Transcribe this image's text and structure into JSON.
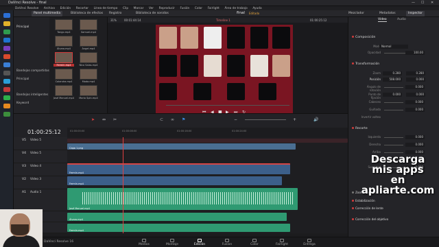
{
  "app": {
    "title": "DaVinci Resolve - final",
    "project_title": "final",
    "edited_label": "Editado"
  },
  "menu": [
    "DaVinci Resolve",
    "Archivo",
    "Edición",
    "Recortar",
    "Línea de tiempo",
    "Clip",
    "Marcar",
    "Ver",
    "Reproducir",
    "Fusión",
    "Color",
    "Fairlight",
    "Área de trabajo",
    "Ayuda"
  ],
  "toolbar": {
    "media_pool": "Panel multimedia",
    "effects": "Biblioteca de efectos",
    "index": "Registro",
    "sound": "Biblioteca de sonidos",
    "mixer": "Mezclador",
    "metadata": "Metadatos",
    "inspector": "Inspector"
  },
  "viewer": {
    "zoom": "31%",
    "src_timecode": "00:01:44:14",
    "timeline_name": "Timeline 1",
    "rec_timecode": "01:00:25:12"
  },
  "left_panel": {
    "master": "Principal",
    "smart_bins": "Bandejas compartidas",
    "key_master": "Principal",
    "smart_bins2": "Bandejas inteligentes",
    "keywords": "Keyword"
  },
  "media_pool": [
    {
      "label": "Tango.mp4"
    },
    {
      "label": "Samuel.mp4"
    },
    {
      "label": "Álvaro.mp4"
    },
    {
      "label": "Ángel.mp4"
    },
    {
      "label": "Fermín.mp4"
    },
    {
      "label": "Nico Salas.mp4"
    },
    {
      "label": "Calandra.mp4"
    },
    {
      "label": "Moda.mp4"
    },
    {
      "label": "José Manuel.mp4"
    },
    {
      "label": "Mario Spin.mp4"
    }
  ],
  "inspector": {
    "tab_video": "Video",
    "tab_audio": "Audio",
    "composite": "Composición",
    "mode_label": "Modo",
    "mode_value": "Normal",
    "opacity_label": "Opacidad",
    "opacity_value": "100.00",
    "transform": "Transformación",
    "zoom_label": "Zoom",
    "zoom_x": "0.280",
    "zoom_y": "0.280",
    "pos_label": "Posición",
    "pos_x": "508.000",
    "pos_y": "0.000",
    "rot_label": "Ángulo de rotación",
    "rot_value": "0.000",
    "anchor_label": "Punto de fijación",
    "anchor_x": "0.000",
    "anchor_y": "0.000",
    "pitch_label": "Cabeceo",
    "pitch_value": "0.000",
    "yaw_label": "Guiñada",
    "yaw_value": "0.000",
    "flip_label": "Invertir volteo",
    "crop": "Recorte",
    "crop_left": "Izquierda",
    "crop_left_v": "0.000",
    "crop_right": "Derecha",
    "crop_right_v": "0.000",
    "crop_top": "Arriba",
    "crop_top_v": "0.000",
    "crop_bottom": "Abajo",
    "crop_bottom_v": "0.000",
    "softness": "Suavidad",
    "softness_v": "0.000",
    "dynamic_zoom": "Zoom dinámico",
    "stabilization": "Estabilización",
    "lens": "Corrección de lente",
    "retime": "Corrección del objetivo"
  },
  "timeline": {
    "timecode": "01:00:25:12",
    "ruler": [
      "01:00:00:00",
      "01:00:08:00",
      "01:00:16:00",
      "01:00:24:00"
    ],
    "tracks": [
      {
        "id": "V5",
        "name": "Video 5"
      },
      {
        "id": "V4",
        "name": "Video 5"
      },
      {
        "id": "V3",
        "name": "Video 4"
      },
      {
        "id": "V2",
        "name": "Video 3"
      },
      {
        "id": "A1",
        "name": "Audio 1"
      },
      {
        "id": "A2",
        "name": ""
      },
      {
        "id": "A3",
        "name": ""
      }
    ],
    "clips": {
      "v5": "Capa 1.png",
      "v3": "Fermín.mp4",
      "v2": "Fermín.mp4",
      "a1": "José Manuel.mp4",
      "a2": "Álvaro.mp4",
      "a3": "Fermín.mp4"
    }
  },
  "pages": [
    "Medios",
    "Montaje",
    "Edición",
    "Fusion",
    "Color",
    "Fairlight",
    "Entrega"
  ],
  "overlay": {
    "line1": "Descarga",
    "line2": "mis apps",
    "line3": "en",
    "line4": "apliarte.com"
  },
  "footer": {
    "version": "DaVinci Resolve 16"
  }
}
